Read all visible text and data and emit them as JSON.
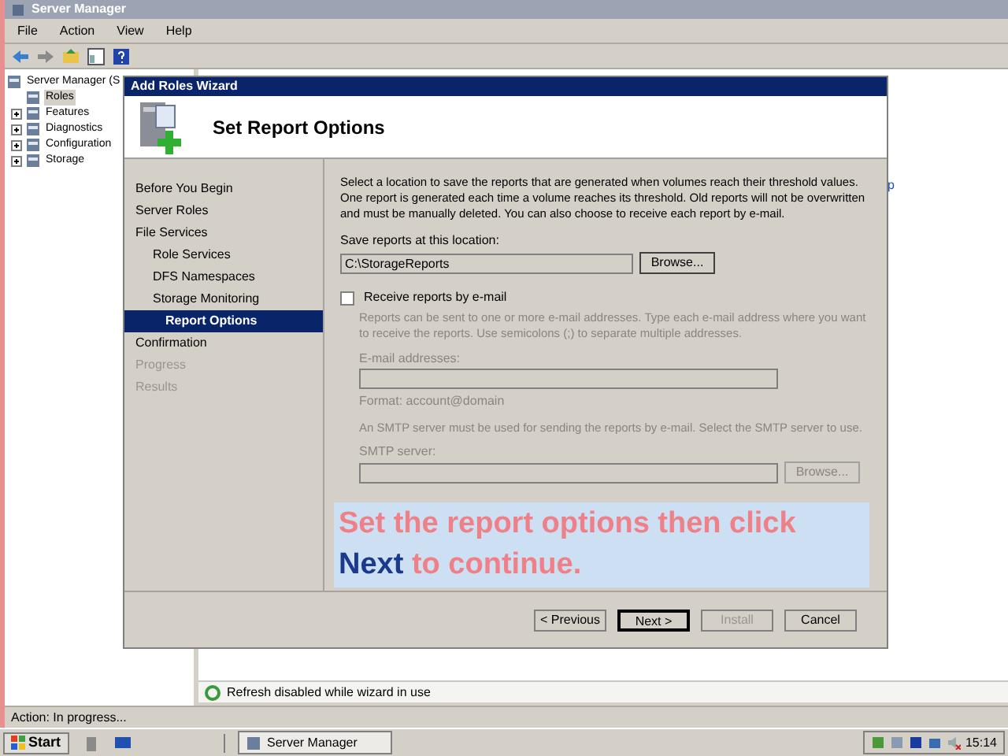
{
  "window": {
    "title": "Server Manager"
  },
  "menu": [
    "File",
    "Action",
    "View",
    "Help"
  ],
  "tree": [
    {
      "label": "Server Manager (S",
      "selected": false,
      "children": [
        {
          "label": "Roles",
          "expandable": false,
          "selected": true
        },
        {
          "label": "Features",
          "expandable": true,
          "selected": false
        },
        {
          "label": "Diagnostics",
          "expandable": true,
          "selected": false
        },
        {
          "label": "Configuration",
          "expandable": true,
          "selected": false
        },
        {
          "label": "Storage",
          "expandable": true,
          "selected": false
        }
      ]
    }
  ],
  "right_pane": {
    "partial_link": "p",
    "status": "Refresh disabled while wizard in use"
  },
  "status_bar": "Action:  In progress...",
  "wizard": {
    "title": "Add Roles Wizard",
    "heading": "Set Report Options",
    "steps": [
      {
        "label": "Before You Begin",
        "selected": false,
        "disabled": false
      },
      {
        "label": "Server Roles",
        "selected": false,
        "disabled": false
      },
      {
        "label": "File Services",
        "selected": false,
        "disabled": false,
        "children": [
          {
            "label": "Role Services",
            "selected": false
          },
          {
            "label": "DFS Namespaces",
            "selected": false
          },
          {
            "label": "Storage Monitoring",
            "selected": false
          },
          {
            "label": "Report Options",
            "selected": true
          }
        ]
      },
      {
        "label": "Confirmation",
        "selected": false,
        "disabled": false
      },
      {
        "label": "Progress",
        "selected": false,
        "disabled": true
      },
      {
        "label": "Results",
        "selected": false,
        "disabled": true
      }
    ],
    "intro": "Select a location to save the reports that are generated when volumes reach their threshold values. One report is generated each time a volume reaches its threshold. Old reports will not be overwritten and must be manually deleted. You can also choose to receive each report by e-mail.",
    "location_label": "Save reports at this location:",
    "location_value": "C:\\StorageReports",
    "browse": "Browse...",
    "email_checkbox": {
      "label": "Receive reports by e-mail",
      "checked": false
    },
    "email_help": "Reports can be sent to one or more e-mail addresses. Type each e-mail address where you want to receive the reports. Use semicolons (;) to separate multiple addresses.",
    "email_label": "E-mail addresses:",
    "email_format": "Format: account@domain",
    "smtp_help": "An SMTP server must be used for sending the reports by e-mail. Select the SMTP server to use.",
    "smtp_label": "SMTP server:",
    "smtp_browse": "Browse...",
    "caption": {
      "before": "Set the report options then click",
      "highlight": "Next",
      "after": "to continue."
    },
    "buttons": [
      {
        "label": "< Previous",
        "disabled": false,
        "default": false
      },
      {
        "label": "Next >",
        "disabled": false,
        "default": true
      },
      {
        "label": "Install",
        "disabled": true,
        "default": false
      },
      {
        "label": "Cancel",
        "disabled": false,
        "default": false
      }
    ]
  },
  "taskbar": {
    "start": "Start",
    "tasks": [
      {
        "label": "Server Manager",
        "selected": true
      }
    ],
    "clock": "15:14"
  }
}
